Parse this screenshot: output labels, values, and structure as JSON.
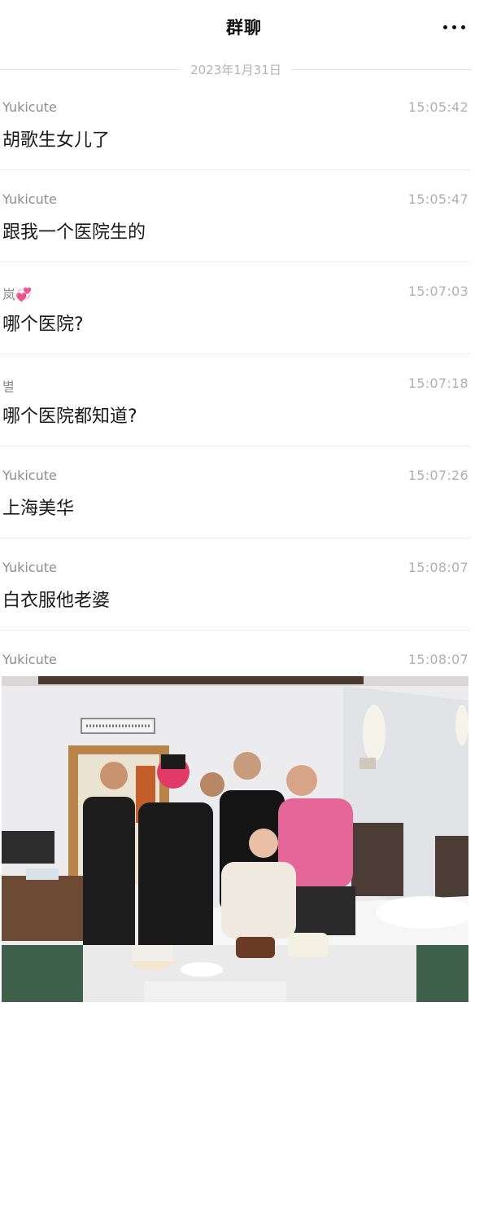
{
  "header": {
    "title": "群聊",
    "more_icon": "more-dots-icon"
  },
  "date_separator": "2023年1月31日",
  "messages": [
    {
      "sender": "Yukicute",
      "time": "15:05:42",
      "text": "胡歌生女儿了"
    },
    {
      "sender": "Yukicute",
      "time": "15:05:47",
      "text": "跟我一个医院生的"
    },
    {
      "sender": "岚💞",
      "time": "15:07:03",
      "text": "哪个医院?"
    },
    {
      "sender": "별",
      "time": "15:07:18",
      "text": "哪个医院都知道?"
    },
    {
      "sender": "Yukicute",
      "time": "15:07:26",
      "text": "上海美华"
    },
    {
      "sender": "Yukicute",
      "time": "15:08:07",
      "text": "白衣服他老婆"
    },
    {
      "sender": "Yukicute",
      "time": "15:08:07",
      "image": "group-photo-with-cakes"
    }
  ],
  "colors": {
    "background": "#ffffff",
    "sender_text": "#8c8c8c",
    "time_text": "#b0b0b0",
    "divider": "#ececec"
  }
}
